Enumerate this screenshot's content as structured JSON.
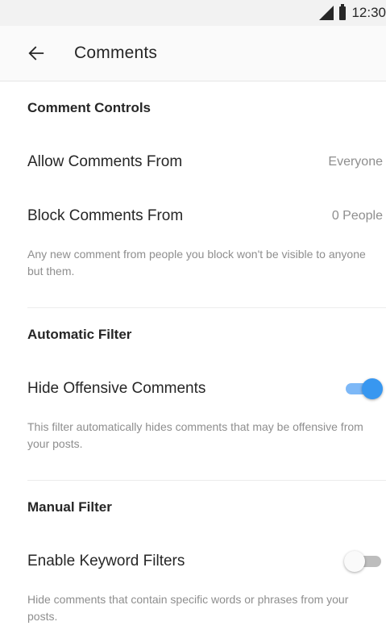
{
  "status_bar": {
    "time": "12:30"
  },
  "header": {
    "title": "Comments",
    "back_icon": "arrow-left-icon"
  },
  "comment_controls": {
    "title": "Comment Controls",
    "allow_label": "Allow Comments From",
    "allow_value": "Everyone",
    "block_label": "Block Comments From",
    "block_value": "0 People",
    "description": "Any new comment from people you block won't be visible to anyone but them."
  },
  "automatic_filter": {
    "title": "Automatic Filter",
    "hide_label": "Hide Offensive Comments",
    "hide_enabled": true,
    "description": "This filter automatically hides comments that may be offensive from your posts."
  },
  "manual_filter": {
    "title": "Manual Filter",
    "keyword_label": "Enable Keyword Filters",
    "keyword_enabled": false,
    "description": "Hide comments that contain specific words or phrases from your posts."
  },
  "colors": {
    "accent": "#3897f0",
    "secondary_text": "#8e8e8e",
    "primary_text": "#262626"
  }
}
